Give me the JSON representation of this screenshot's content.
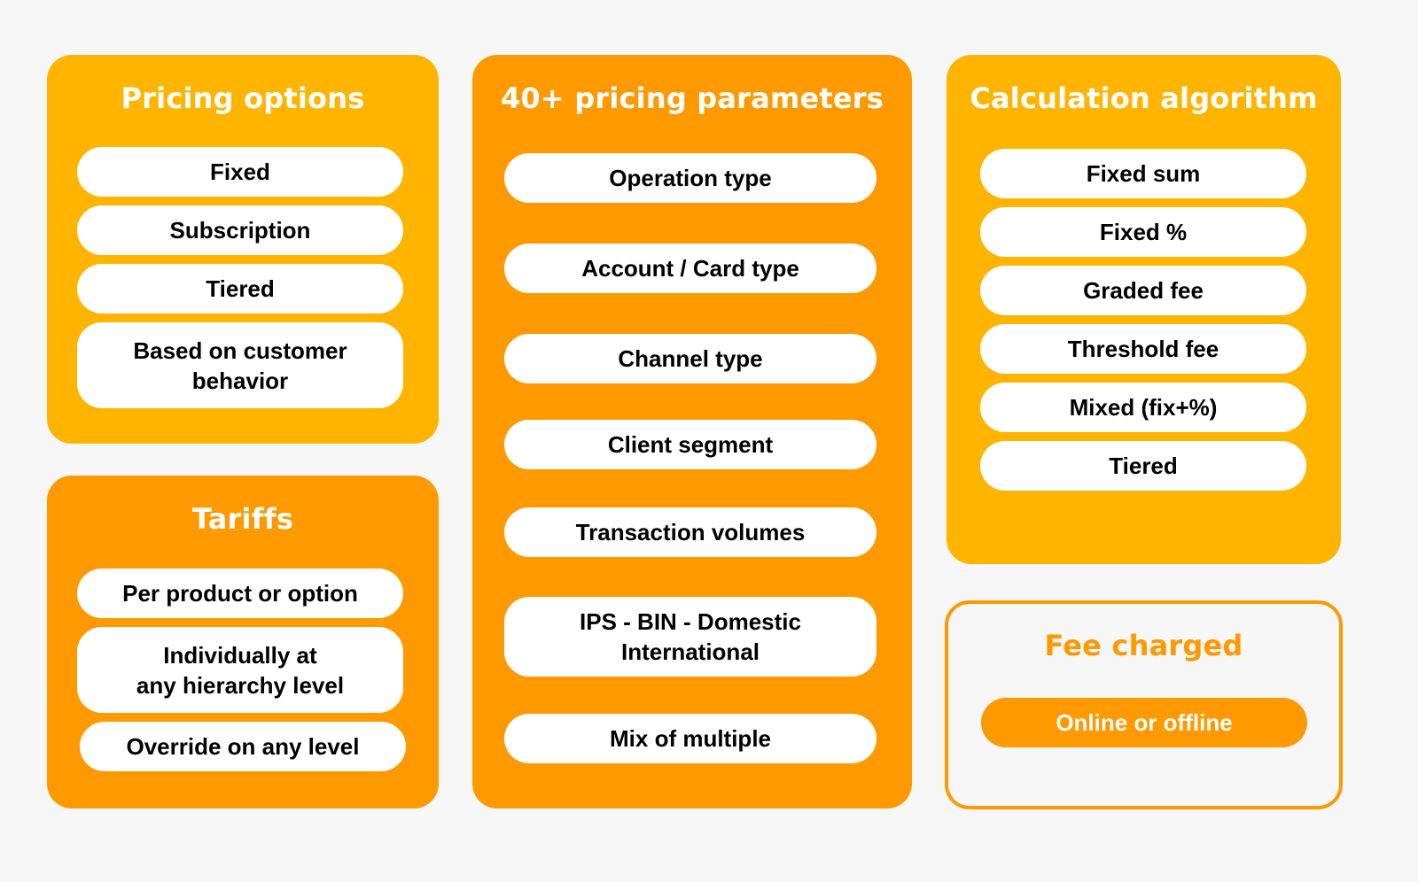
{
  "colors": {
    "background": "#f7f7f7",
    "yellow": "#ffb400",
    "orange": "#ff9900",
    "pill": "#ffffff",
    "text_dark": "#000000",
    "text_light": "#ffffff"
  },
  "pricing_options": {
    "title": "Pricing options",
    "items": [
      "Fixed",
      "Subscription",
      "Tiered",
      "Based on customer\nbehavior"
    ]
  },
  "tariffs": {
    "title": "Tariffs",
    "items": [
      "Per product or option",
      "Individually at\nany hierarchy level",
      "Override on any level"
    ]
  },
  "pricing_parameters": {
    "title": "40+ pricing parameters",
    "items": [
      "Operation type",
      "Account / Card type",
      "Channel type",
      "Client segment",
      "Transaction volumes",
      "IPS - BIN - Domestic\nInternational",
      "Mix of multiple"
    ]
  },
  "calculation_algorithm": {
    "title": "Calculation algorithm",
    "items": [
      "Fixed sum",
      "Fixed %",
      "Graded fee",
      "Threshold fee",
      "Mixed (fix+%)",
      "Tiered"
    ]
  },
  "fee_charged": {
    "title": "Fee charged",
    "items": [
      "Online or offline"
    ]
  }
}
